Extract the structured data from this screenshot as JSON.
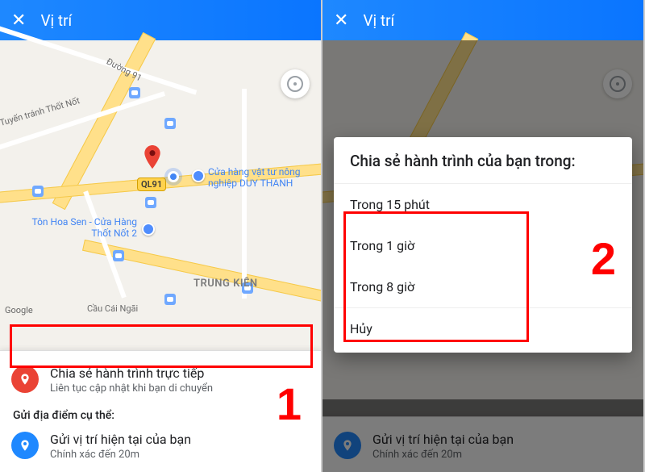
{
  "header": {
    "title": "Vị trí"
  },
  "map": {
    "road_label_1": "Đường 91",
    "road_label_2": "Tuyến tránh Thốt Nốt",
    "shield_label": "QL91",
    "poi1": "Cửa hàng vật tư nông nghiệp DUY THANH",
    "poi2": "Tôn Hoa Sen - Cửa Hàng Thốt Nốt 2",
    "area_label": "TRUNG KIÊN",
    "bridge_label": "Cầu Cái Ngãi",
    "attribution": "Google"
  },
  "sheet": {
    "share_title": "Chia sẻ hành trình trực tiếp",
    "share_sub": "Liên tục cập nhật khi bạn di chuyển",
    "section_label": "Gửi địa điểm cụ thể:",
    "current_title": "Gửi vị trí hiện tại của bạn",
    "current_sub": "Chính xác đến 20m"
  },
  "dialog": {
    "title": "Chia sẻ hành trình của bạn trong:",
    "options": [
      "Trong 15 phút",
      "Trong 1 giờ",
      "Trong 8 giờ"
    ],
    "cancel": "Hủy"
  },
  "steps": {
    "one": "1",
    "two": "2"
  }
}
